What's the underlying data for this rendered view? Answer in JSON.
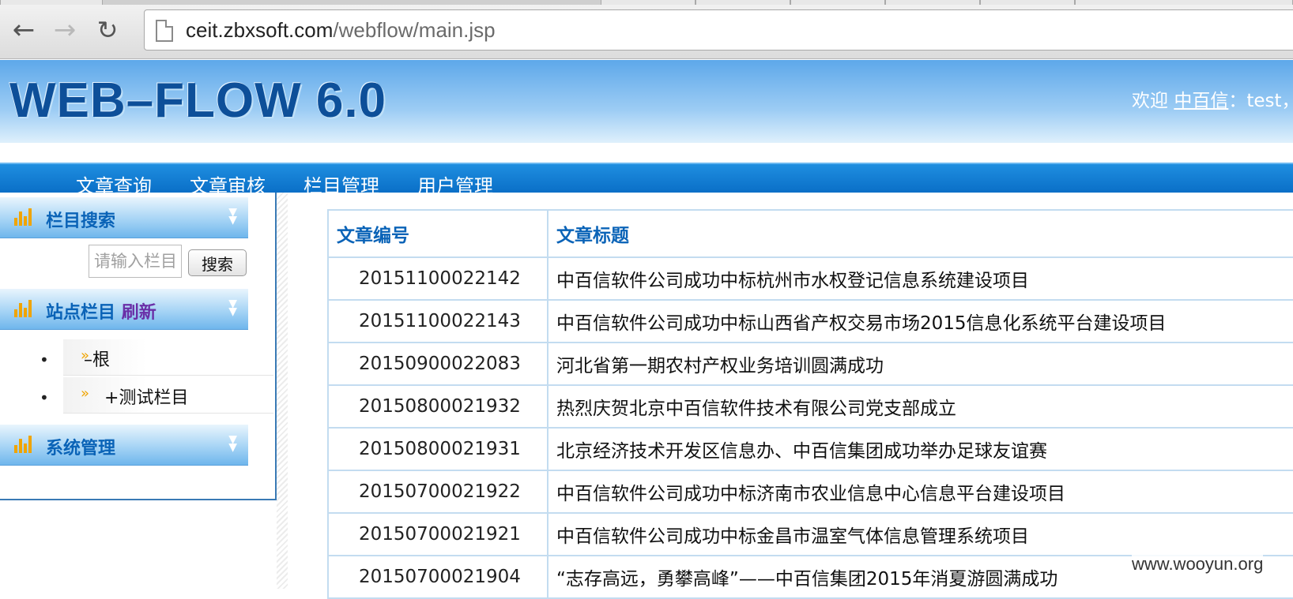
{
  "browser": {
    "url_domain": "ceit.zbxsoft.com",
    "url_path": "/webflow/main.jsp",
    "back_icon": "back-arrow-icon",
    "forward_icon": "forward-arrow-icon",
    "reload_icon": "reload-icon"
  },
  "header": {
    "logo": "WEB–FLOW 6.0",
    "welcome_prefix": "欢迎",
    "welcome_user": "中百信",
    "welcome_suffix": "：test，"
  },
  "menu": {
    "items": [
      "文章查询",
      "文章审核",
      "栏目管理",
      "用户管理"
    ]
  },
  "sidebar": {
    "search_panel_title": "栏目搜索",
    "search_placeholder": "请输入栏目",
    "search_button": "搜索",
    "site_panel_title": "站点栏目",
    "site_panel_refresh": "刷新",
    "tree": [
      {
        "label": "根",
        "prefix": "–"
      },
      {
        "label": "测试栏目",
        "prefix": "+"
      }
    ],
    "system_panel_title": "系统管理"
  },
  "table": {
    "headers": [
      "文章编号",
      "文章标题"
    ],
    "rows": [
      {
        "id": "20151100022142",
        "title": "中百信软件公司成功中标杭州市水权登记信息系统建设项目"
      },
      {
        "id": "20151100022143",
        "title": "中百信软件公司成功中标山西省产权交易市场2015信息化系统平台建设项目"
      },
      {
        "id": "20150900022083",
        "title": "河北省第一期农村产权业务培训圆满成功"
      },
      {
        "id": "20150800021932",
        "title": "热烈庆贺北京中百信软件技术有限公司党支部成立"
      },
      {
        "id": "20150800021931",
        "title": "北京经济技术开发区信息办、中百信集团成功举办足球友谊赛"
      },
      {
        "id": "20150700021922",
        "title": "中百信软件公司成功中标济南市农业信息中心信息平台建设项目"
      },
      {
        "id": "20150700021921",
        "title": "中百信软件公司成功中标金昌市温室气体信息管理系统项目"
      },
      {
        "id": "20150700021904",
        "title": "“志存高远，勇攀高峰”——中百信集团2015年消夏游圆满成功"
      }
    ]
  },
  "watermark": "www.wooyun.org",
  "colors": {
    "menubar": "#0a6fc7",
    "panel_title": "#0a63b7",
    "accent_orange": "#f0a400"
  }
}
